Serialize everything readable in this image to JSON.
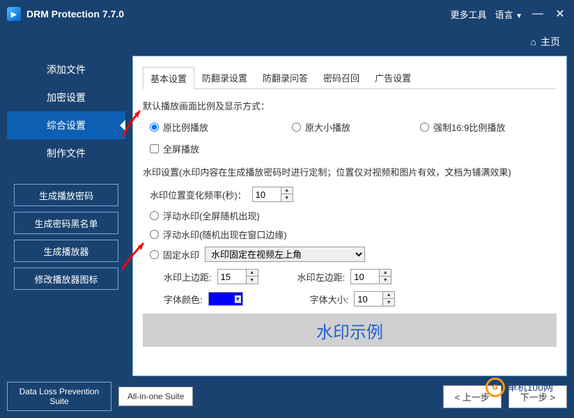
{
  "titlebar": {
    "title": "DRM Protection 7.7.0",
    "more_tools": "更多工具",
    "language": "语言"
  },
  "breadcrumb": {
    "home": "主页"
  },
  "sidebar": {
    "nav": [
      {
        "label": "添加文件"
      },
      {
        "label": "加密设置"
      },
      {
        "label": "综合设置",
        "active": true
      },
      {
        "label": "制作文件"
      }
    ],
    "buttons": [
      {
        "label": "生成播放密码"
      },
      {
        "label": "生成密码黑名单"
      },
      {
        "label": "生成播放器"
      },
      {
        "label": "修改播放器图标"
      }
    ]
  },
  "tabs": [
    {
      "label": "基本设置",
      "active": true
    },
    {
      "label": "防翻录设置"
    },
    {
      "label": "防翻录问答"
    },
    {
      "label": "密码召回"
    },
    {
      "label": "广告设置"
    }
  ],
  "content": {
    "display_mode_label": "默认播放画面比例及显示方式：",
    "ratio_options": {
      "original_ratio": "原比例播放",
      "original_size": "原大小播放",
      "force_169": "强制16:9比例播放"
    },
    "fullscreen_label": "全屏播放",
    "watermark_section_label": "水印设置(水印内容在生成播放密码时进行定制；位置仅对视频和图片有效，文档为铺满效果)",
    "freq_label": "水印位置变化频率(秒)：",
    "freq_value": "10",
    "float_full_label": "浮动水印(全屏随机出现)",
    "float_edge_label": "浮动水印(随机出现在窗口边缘)",
    "fixed_label": "固定水印",
    "fixed_position_options": [
      "水印固定在视频左上角"
    ],
    "fixed_position_value": "水印固定在视频左上角",
    "margin_top_label": "水印上边距:",
    "margin_top_value": "15",
    "margin_left_label": "水印左边距:",
    "margin_left_value": "10",
    "font_color_label": "字体颜色:",
    "font_color_value": "#0000ff",
    "font_size_label": "字体大小:",
    "font_size_value": "10",
    "preview_text": "水印示例"
  },
  "footer": {
    "suite1": "Data Loss Prevention Suite",
    "suite2": "All-in-one Suite",
    "prev": "< 上一步",
    "next": "下一步 >"
  },
  "watermark_site": "单机100网"
}
